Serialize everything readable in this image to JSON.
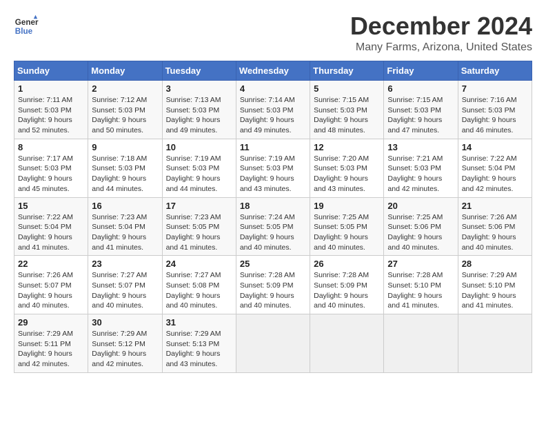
{
  "logo": {
    "line1": "General",
    "line2": "Blue"
  },
  "title": "December 2024",
  "location": "Many Farms, Arizona, United States",
  "columns": [
    "Sunday",
    "Monday",
    "Tuesday",
    "Wednesday",
    "Thursday",
    "Friday",
    "Saturday"
  ],
  "weeks": [
    [
      {
        "day": "1",
        "info": "Sunrise: 7:11 AM\nSunset: 5:03 PM\nDaylight: 9 hours\nand 52 minutes."
      },
      {
        "day": "2",
        "info": "Sunrise: 7:12 AM\nSunset: 5:03 PM\nDaylight: 9 hours\nand 50 minutes."
      },
      {
        "day": "3",
        "info": "Sunrise: 7:13 AM\nSunset: 5:03 PM\nDaylight: 9 hours\nand 49 minutes."
      },
      {
        "day": "4",
        "info": "Sunrise: 7:14 AM\nSunset: 5:03 PM\nDaylight: 9 hours\nand 49 minutes."
      },
      {
        "day": "5",
        "info": "Sunrise: 7:15 AM\nSunset: 5:03 PM\nDaylight: 9 hours\nand 48 minutes."
      },
      {
        "day": "6",
        "info": "Sunrise: 7:15 AM\nSunset: 5:03 PM\nDaylight: 9 hours\nand 47 minutes."
      },
      {
        "day": "7",
        "info": "Sunrise: 7:16 AM\nSunset: 5:03 PM\nDaylight: 9 hours\nand 46 minutes."
      }
    ],
    [
      {
        "day": "8",
        "info": "Sunrise: 7:17 AM\nSunset: 5:03 PM\nDaylight: 9 hours\nand 45 minutes."
      },
      {
        "day": "9",
        "info": "Sunrise: 7:18 AM\nSunset: 5:03 PM\nDaylight: 9 hours\nand 44 minutes."
      },
      {
        "day": "10",
        "info": "Sunrise: 7:19 AM\nSunset: 5:03 PM\nDaylight: 9 hours\nand 44 minutes."
      },
      {
        "day": "11",
        "info": "Sunrise: 7:19 AM\nSunset: 5:03 PM\nDaylight: 9 hours\nand 43 minutes."
      },
      {
        "day": "12",
        "info": "Sunrise: 7:20 AM\nSunset: 5:03 PM\nDaylight: 9 hours\nand 43 minutes."
      },
      {
        "day": "13",
        "info": "Sunrise: 7:21 AM\nSunset: 5:03 PM\nDaylight: 9 hours\nand 42 minutes."
      },
      {
        "day": "14",
        "info": "Sunrise: 7:22 AM\nSunset: 5:04 PM\nDaylight: 9 hours\nand 42 minutes."
      }
    ],
    [
      {
        "day": "15",
        "info": "Sunrise: 7:22 AM\nSunset: 5:04 PM\nDaylight: 9 hours\nand 41 minutes."
      },
      {
        "day": "16",
        "info": "Sunrise: 7:23 AM\nSunset: 5:04 PM\nDaylight: 9 hours\nand 41 minutes."
      },
      {
        "day": "17",
        "info": "Sunrise: 7:23 AM\nSunset: 5:05 PM\nDaylight: 9 hours\nand 41 minutes."
      },
      {
        "day": "18",
        "info": "Sunrise: 7:24 AM\nSunset: 5:05 PM\nDaylight: 9 hours\nand 40 minutes."
      },
      {
        "day": "19",
        "info": "Sunrise: 7:25 AM\nSunset: 5:05 PM\nDaylight: 9 hours\nand 40 minutes."
      },
      {
        "day": "20",
        "info": "Sunrise: 7:25 AM\nSunset: 5:06 PM\nDaylight: 9 hours\nand 40 minutes."
      },
      {
        "day": "21",
        "info": "Sunrise: 7:26 AM\nSunset: 5:06 PM\nDaylight: 9 hours\nand 40 minutes."
      }
    ],
    [
      {
        "day": "22",
        "info": "Sunrise: 7:26 AM\nSunset: 5:07 PM\nDaylight: 9 hours\nand 40 minutes."
      },
      {
        "day": "23",
        "info": "Sunrise: 7:27 AM\nSunset: 5:07 PM\nDaylight: 9 hours\nand 40 minutes."
      },
      {
        "day": "24",
        "info": "Sunrise: 7:27 AM\nSunset: 5:08 PM\nDaylight: 9 hours\nand 40 minutes."
      },
      {
        "day": "25",
        "info": "Sunrise: 7:28 AM\nSunset: 5:09 PM\nDaylight: 9 hours\nand 40 minutes."
      },
      {
        "day": "26",
        "info": "Sunrise: 7:28 AM\nSunset: 5:09 PM\nDaylight: 9 hours\nand 40 minutes."
      },
      {
        "day": "27",
        "info": "Sunrise: 7:28 AM\nSunset: 5:10 PM\nDaylight: 9 hours\nand 41 minutes."
      },
      {
        "day": "28",
        "info": "Sunrise: 7:29 AM\nSunset: 5:10 PM\nDaylight: 9 hours\nand 41 minutes."
      }
    ],
    [
      {
        "day": "29",
        "info": "Sunrise: 7:29 AM\nSunset: 5:11 PM\nDaylight: 9 hours\nand 42 minutes."
      },
      {
        "day": "30",
        "info": "Sunrise: 7:29 AM\nSunset: 5:12 PM\nDaylight: 9 hours\nand 42 minutes."
      },
      {
        "day": "31",
        "info": "Sunrise: 7:29 AM\nSunset: 5:13 PM\nDaylight: 9 hours\nand 43 minutes."
      },
      {
        "day": "",
        "info": ""
      },
      {
        "day": "",
        "info": ""
      },
      {
        "day": "",
        "info": ""
      },
      {
        "day": "",
        "info": ""
      }
    ]
  ]
}
